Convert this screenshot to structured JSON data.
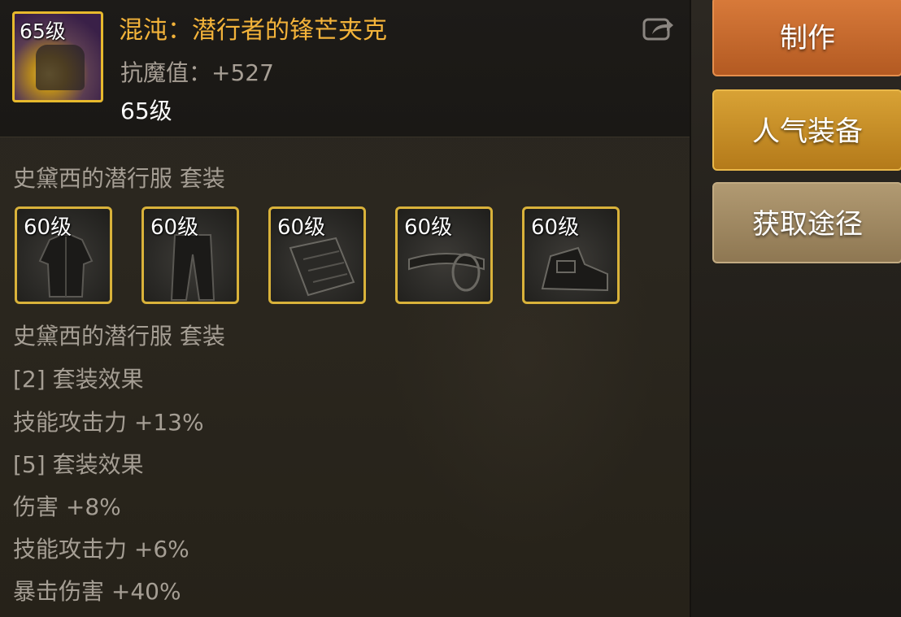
{
  "item": {
    "level_badge": "65级",
    "name": "混沌：潜行者的锋芒夹克",
    "stat": "抗魔值：+527",
    "level_text": "65级"
  },
  "set": {
    "heading": "史黛西的潜行服 套装",
    "pieces": [
      {
        "level": "60级",
        "icon": "jacket-icon"
      },
      {
        "level": "60级",
        "icon": "pants-icon"
      },
      {
        "level": "60级",
        "icon": "shoulder-icon"
      },
      {
        "level": "60级",
        "icon": "belt-icon"
      },
      {
        "level": "60级",
        "icon": "shoes-icon"
      }
    ],
    "heading2": "史黛西的潜行服 套装",
    "effects": [
      "[2] 套装效果",
      "技能攻击力 +13%",
      "[5] 套装效果",
      "伤害 +8%",
      "技能攻击力 +6%",
      "暴击伤害 +40%"
    ]
  },
  "actions": {
    "make": "制作",
    "popular": "人气装备",
    "obtain": "获取途径"
  },
  "colors": {
    "title": "#f3b33a",
    "frame": "#e7b92d",
    "make_button": "#c8692c",
    "popular_button": "#c88d25",
    "obtain_button": "#a08964"
  }
}
